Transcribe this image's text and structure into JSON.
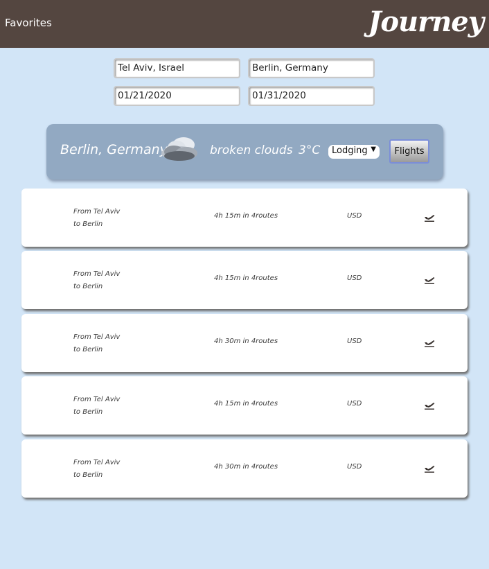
{
  "header": {
    "favorites_label": "Favorites",
    "logo_text": "Journey",
    "bg_color": "#544640"
  },
  "search": {
    "origin": "Tel Aviv, Israel",
    "destination": "Berlin, Germany",
    "start_date": "01/21/2020",
    "end_date": "01/31/2020"
  },
  "weather": {
    "city": "Berlin, Germany",
    "icon": "broken-clouds-icon",
    "description": "broken clouds",
    "temperature": "3°C",
    "category_selected": "Lodging",
    "flights_button": "Flights"
  },
  "flights": [
    {
      "from": "From Tel Aviv",
      "to": "to Berlin",
      "duration": "4h 15m in 4routes",
      "currency": "USD",
      "icon": "airplane-icon"
    },
    {
      "from": "From Tel Aviv",
      "to": "to Berlin",
      "duration": "4h 15m in 4routes",
      "currency": "USD",
      "icon": "airplane-icon"
    },
    {
      "from": "From Tel Aviv",
      "to": "to Berlin",
      "duration": "4h 30m in 4routes",
      "currency": "USD",
      "icon": "airplane-icon"
    },
    {
      "from": "From Tel Aviv",
      "to": "to Berlin",
      "duration": "4h 15m in 4routes",
      "currency": "USD",
      "icon": "airplane-icon"
    },
    {
      "from": "From Tel Aviv",
      "to": "to Berlin",
      "duration": "4h 30m in 4routes",
      "currency": "USD",
      "icon": "airplane-icon"
    }
  ],
  "colors": {
    "page_bg": "#d2e5f7",
    "weather_bar": "#92a9c2"
  }
}
